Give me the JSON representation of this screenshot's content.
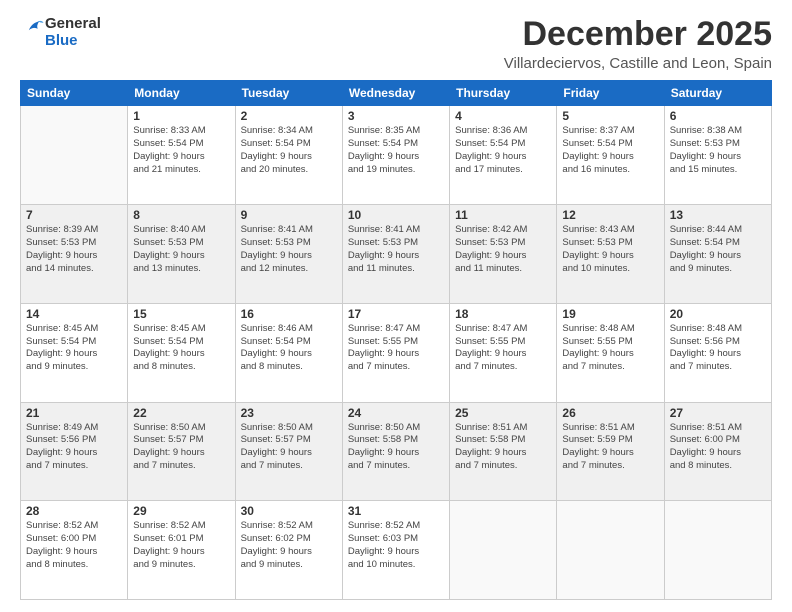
{
  "logo": {
    "general": "General",
    "blue": "Blue"
  },
  "title": "December 2025",
  "location": "Villardeciervos, Castille and Leon, Spain",
  "days_header": [
    "Sunday",
    "Monday",
    "Tuesday",
    "Wednesday",
    "Thursday",
    "Friday",
    "Saturday"
  ],
  "weeks": [
    [
      {
        "day": "",
        "info": ""
      },
      {
        "day": "1",
        "info": "Sunrise: 8:33 AM\nSunset: 5:54 PM\nDaylight: 9 hours\nand 21 minutes."
      },
      {
        "day": "2",
        "info": "Sunrise: 8:34 AM\nSunset: 5:54 PM\nDaylight: 9 hours\nand 20 minutes."
      },
      {
        "day": "3",
        "info": "Sunrise: 8:35 AM\nSunset: 5:54 PM\nDaylight: 9 hours\nand 19 minutes."
      },
      {
        "day": "4",
        "info": "Sunrise: 8:36 AM\nSunset: 5:54 PM\nDaylight: 9 hours\nand 17 minutes."
      },
      {
        "day": "5",
        "info": "Sunrise: 8:37 AM\nSunset: 5:54 PM\nDaylight: 9 hours\nand 16 minutes."
      },
      {
        "day": "6",
        "info": "Sunrise: 8:38 AM\nSunset: 5:53 PM\nDaylight: 9 hours\nand 15 minutes."
      }
    ],
    [
      {
        "day": "7",
        "info": "Sunrise: 8:39 AM\nSunset: 5:53 PM\nDaylight: 9 hours\nand 14 minutes."
      },
      {
        "day": "8",
        "info": "Sunrise: 8:40 AM\nSunset: 5:53 PM\nDaylight: 9 hours\nand 13 minutes."
      },
      {
        "day": "9",
        "info": "Sunrise: 8:41 AM\nSunset: 5:53 PM\nDaylight: 9 hours\nand 12 minutes."
      },
      {
        "day": "10",
        "info": "Sunrise: 8:41 AM\nSunset: 5:53 PM\nDaylight: 9 hours\nand 11 minutes."
      },
      {
        "day": "11",
        "info": "Sunrise: 8:42 AM\nSunset: 5:53 PM\nDaylight: 9 hours\nand 11 minutes."
      },
      {
        "day": "12",
        "info": "Sunrise: 8:43 AM\nSunset: 5:53 PM\nDaylight: 9 hours\nand 10 minutes."
      },
      {
        "day": "13",
        "info": "Sunrise: 8:44 AM\nSunset: 5:54 PM\nDaylight: 9 hours\nand 9 minutes."
      }
    ],
    [
      {
        "day": "14",
        "info": "Sunrise: 8:45 AM\nSunset: 5:54 PM\nDaylight: 9 hours\nand 9 minutes."
      },
      {
        "day": "15",
        "info": "Sunrise: 8:45 AM\nSunset: 5:54 PM\nDaylight: 9 hours\nand 8 minutes."
      },
      {
        "day": "16",
        "info": "Sunrise: 8:46 AM\nSunset: 5:54 PM\nDaylight: 9 hours\nand 8 minutes."
      },
      {
        "day": "17",
        "info": "Sunrise: 8:47 AM\nSunset: 5:55 PM\nDaylight: 9 hours\nand 7 minutes."
      },
      {
        "day": "18",
        "info": "Sunrise: 8:47 AM\nSunset: 5:55 PM\nDaylight: 9 hours\nand 7 minutes."
      },
      {
        "day": "19",
        "info": "Sunrise: 8:48 AM\nSunset: 5:55 PM\nDaylight: 9 hours\nand 7 minutes."
      },
      {
        "day": "20",
        "info": "Sunrise: 8:48 AM\nSunset: 5:56 PM\nDaylight: 9 hours\nand 7 minutes."
      }
    ],
    [
      {
        "day": "21",
        "info": "Sunrise: 8:49 AM\nSunset: 5:56 PM\nDaylight: 9 hours\nand 7 minutes."
      },
      {
        "day": "22",
        "info": "Sunrise: 8:50 AM\nSunset: 5:57 PM\nDaylight: 9 hours\nand 7 minutes."
      },
      {
        "day": "23",
        "info": "Sunrise: 8:50 AM\nSunset: 5:57 PM\nDaylight: 9 hours\nand 7 minutes."
      },
      {
        "day": "24",
        "info": "Sunrise: 8:50 AM\nSunset: 5:58 PM\nDaylight: 9 hours\nand 7 minutes."
      },
      {
        "day": "25",
        "info": "Sunrise: 8:51 AM\nSunset: 5:58 PM\nDaylight: 9 hours\nand 7 minutes."
      },
      {
        "day": "26",
        "info": "Sunrise: 8:51 AM\nSunset: 5:59 PM\nDaylight: 9 hours\nand 7 minutes."
      },
      {
        "day": "27",
        "info": "Sunrise: 8:51 AM\nSunset: 6:00 PM\nDaylight: 9 hours\nand 8 minutes."
      }
    ],
    [
      {
        "day": "28",
        "info": "Sunrise: 8:52 AM\nSunset: 6:00 PM\nDaylight: 9 hours\nand 8 minutes."
      },
      {
        "day": "29",
        "info": "Sunrise: 8:52 AM\nSunset: 6:01 PM\nDaylight: 9 hours\nand 9 minutes."
      },
      {
        "day": "30",
        "info": "Sunrise: 8:52 AM\nSunset: 6:02 PM\nDaylight: 9 hours\nand 9 minutes."
      },
      {
        "day": "31",
        "info": "Sunrise: 8:52 AM\nSunset: 6:03 PM\nDaylight: 9 hours\nand 10 minutes."
      },
      {
        "day": "",
        "info": ""
      },
      {
        "day": "",
        "info": ""
      },
      {
        "day": "",
        "info": ""
      }
    ]
  ]
}
